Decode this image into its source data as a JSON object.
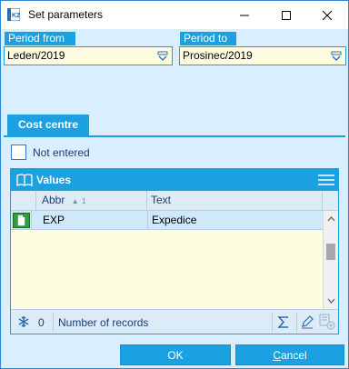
{
  "window": {
    "title": "Set parameters",
    "app_icon": "k2-app-icon",
    "controls": [
      "minimize-icon",
      "maximize-icon",
      "close-icon"
    ]
  },
  "period_from": {
    "label": "Period from",
    "value": "Leden/2019"
  },
  "period_to": {
    "label": "Period to",
    "value": "Prosinec/2019"
  },
  "tabs": [
    {
      "label": "Cost centre",
      "active": true
    }
  ],
  "not_entered": {
    "label": "Not entered",
    "checked": false
  },
  "values_grid": {
    "title": "Values",
    "columns": [
      {
        "label": "Abbr",
        "sort_marker": "▲",
        "sort_index": "1"
      },
      {
        "label": "Text"
      }
    ],
    "rows": [
      {
        "abbr": "EXP",
        "text": "Expedice",
        "selected": true
      }
    ],
    "footer": {
      "count": "0",
      "records_label": "Number of records"
    }
  },
  "buttons": {
    "ok": "OK",
    "cancel_first": "C",
    "cancel_rest": "ancel"
  },
  "colors": {
    "accent": "#1ba1e2",
    "panel": "#d9efff",
    "input_bg": "#fdfde2",
    "selected_row": "#cfe8fa"
  }
}
